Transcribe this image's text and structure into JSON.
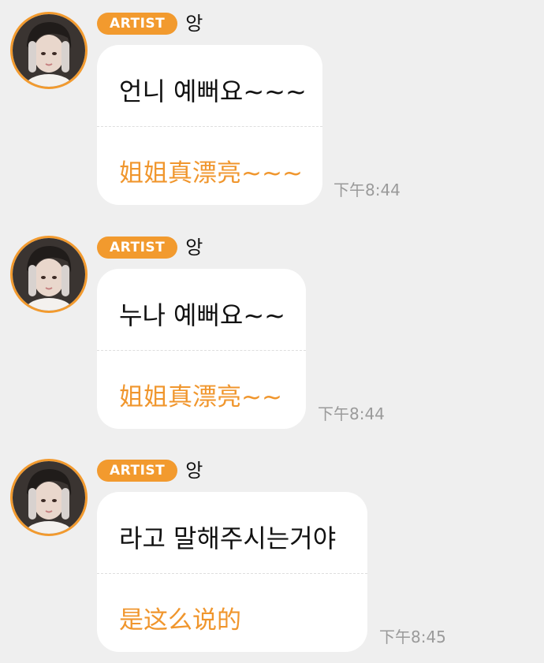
{
  "messages": [
    {
      "badge": "ARTIST",
      "sender": "앙",
      "korean": "언니 예뻐요~~~",
      "chinese": "姐姐真漂亮~~~",
      "time": "下午8:44"
    },
    {
      "badge": "ARTIST",
      "sender": "앙",
      "korean": "누나 예뻐요~~",
      "chinese": "姐姐真漂亮~~",
      "time": "下午8:44"
    },
    {
      "badge": "ARTIST",
      "sender": "앙",
      "korean": "라고 말해주시는거야",
      "chinese": "是这么说的",
      "time": "下午8:45"
    }
  ],
  "colors": {
    "background": "#efefef",
    "accent": "#f29a2e",
    "translation_text": "#f0962d",
    "bubble": "#ffffff",
    "timestamp": "#9a9a9a"
  },
  "icons": {
    "avatar": "artist-profile-photo"
  }
}
